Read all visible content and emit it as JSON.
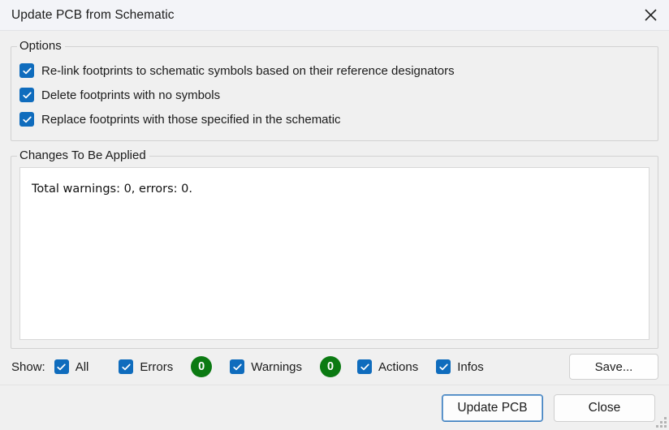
{
  "window": {
    "title": "Update PCB from Schematic",
    "close_icon": "close-icon"
  },
  "options": {
    "legend": "Options",
    "items": [
      {
        "label": "Re-link footprints to schematic symbols based on their reference designators",
        "checked": true
      },
      {
        "label": "Delete footprints with no symbols",
        "checked": true
      },
      {
        "label": "Replace footprints with those specified in the schematic",
        "checked": true
      }
    ]
  },
  "changes": {
    "legend": "Changes To Be Applied",
    "log_lines": [
      "Total warnings: 0, errors: 0."
    ]
  },
  "show": {
    "label": "Show:",
    "filters": [
      {
        "label": "All",
        "checked": true,
        "badge": null
      },
      {
        "label": "Errors",
        "checked": true,
        "badge": "0"
      },
      {
        "label": "Warnings",
        "checked": true,
        "badge": "0"
      },
      {
        "label": "Actions",
        "checked": true,
        "badge": null
      },
      {
        "label": "Infos",
        "checked": true,
        "badge": null
      }
    ],
    "save_label": "Save..."
  },
  "footer": {
    "update_label": "Update PCB",
    "close_label": "Close"
  },
  "colors": {
    "checkbox": "#0f6cbd",
    "badge_green": "#0b7a12",
    "focus_border": "#3c7ebf",
    "titlebar_bg": "#f3f4f8",
    "dialog_bg": "#f0f0f0"
  }
}
